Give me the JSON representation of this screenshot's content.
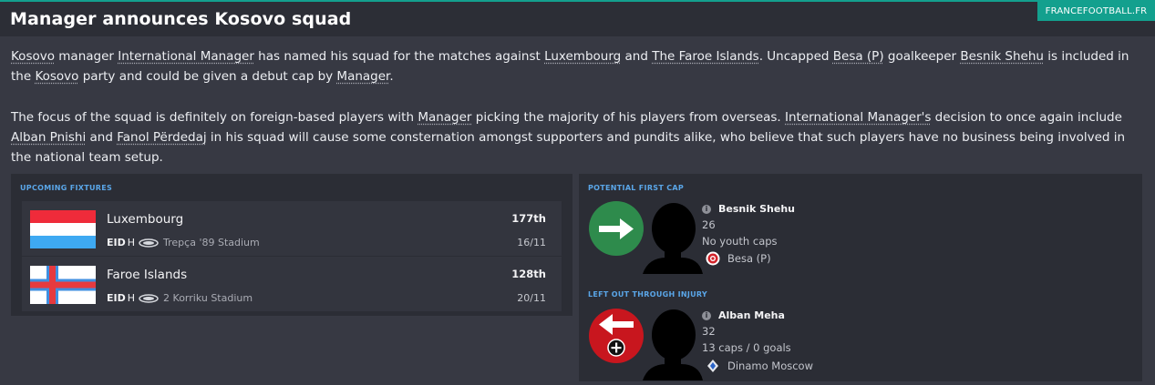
{
  "header": {
    "title": "Manager announces Kosovo squad",
    "brand": "FRANCEFOOTBALL.FR"
  },
  "article": {
    "p1": [
      {
        "t": "Kosovo",
        "link": true
      },
      {
        "t": " manager "
      },
      {
        "t": "International Manager",
        "link": true
      },
      {
        "t": " has named his squad for the matches against "
      },
      {
        "t": "Luxembourg",
        "link": true
      },
      {
        "t": " and "
      },
      {
        "t": "The Faroe Islands",
        "link": true
      },
      {
        "t": ". Uncapped "
      },
      {
        "t": "Besa (P)",
        "link": true
      },
      {
        "t": " goalkeeper "
      },
      {
        "t": "Besnik Shehu",
        "link": true
      },
      {
        "t": " is included in the "
      },
      {
        "t": "Kosovo",
        "link": true
      },
      {
        "t": " party and could be given a debut cap by "
      },
      {
        "t": "Manager",
        "link": true
      },
      {
        "t": "."
      }
    ],
    "p2": [
      {
        "t": "The focus of the squad is definitely on foreign-based players with "
      },
      {
        "t": "Manager",
        "link": true
      },
      {
        "t": " picking the majority of his players from overseas. "
      },
      {
        "t": "International Manager's",
        "link": true
      },
      {
        "t": " decision to once again include "
      },
      {
        "t": "Alban Pnishi",
        "link": true
      },
      {
        "t": " and "
      },
      {
        "t": "Fanol Përdedaj",
        "link": true
      },
      {
        "t": " in his squad will cause some consternation amongst supporters and pundits alike, who believe that such players have no business being involved in the national team setup."
      }
    ]
  },
  "fixtures": {
    "label": "UPCOMING FIXTURES",
    "items": [
      {
        "team": "Luxembourg",
        "rank": "177th",
        "comp": "EID",
        "venue_flag": "H",
        "stadium": "Trepça '89 Stadium",
        "date": "16/11",
        "flag_icon": "luxembourg-flag"
      },
      {
        "team": "Faroe Islands",
        "rank": "128th",
        "comp": "EID",
        "venue_flag": "H",
        "stadium": "2 Korriku Stadium",
        "date": "20/11",
        "flag_icon": "faroe-islands-flag"
      }
    ]
  },
  "first_cap": {
    "label": "POTENTIAL FIRST CAP",
    "name": "Besnik Shehu",
    "age": "26",
    "caps": "No youth caps",
    "club": "Besa (P)"
  },
  "injury": {
    "label": "LEFT OUT THROUGH INJURY",
    "name": "Alban Meha",
    "age": "32",
    "caps": "13 caps / 0 goals",
    "club": "Dinamo Moscow"
  },
  "colors": {
    "accent": "#13a08e",
    "label_blue": "#5aa6e8",
    "in_green": "#2e8b4c",
    "out_red": "#c8161e"
  }
}
